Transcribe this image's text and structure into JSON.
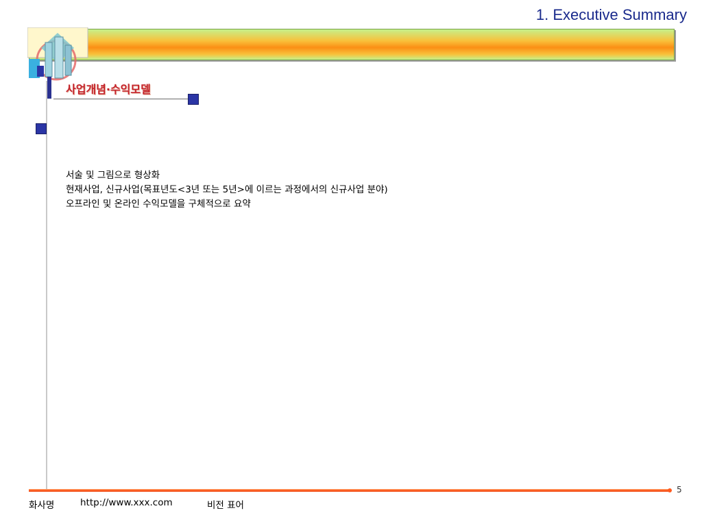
{
  "header": {
    "title": "1. Executive Summary"
  },
  "section": {
    "subtitle": "사업개념·수익모델"
  },
  "content": {
    "lines": [
      "서술 및 그림으로 형상화",
      "현재사업, 신규사업(목표년도<3년 또는 5년>에 이르는 과정에서의 신규사업 분야)",
      "오프라인 및 온라인 수익모델을 구체적으로 요약"
    ]
  },
  "footer": {
    "company": "화사명",
    "url": "http://www.xxx.com",
    "vision": "비전 표어",
    "page_number": "5"
  },
  "colors": {
    "banner_orange": "#fb8f15",
    "banner_green": "#c6f08a",
    "title_blue": "#1a2a8c",
    "subtitle_red": "#c4232b",
    "accent_square": "#2b35a5",
    "footer_line": "#ff5a1e"
  }
}
